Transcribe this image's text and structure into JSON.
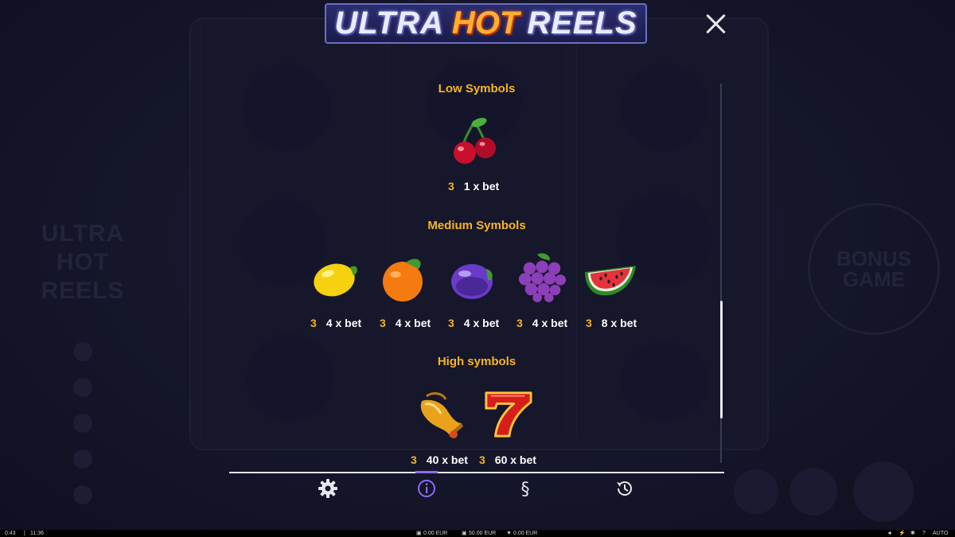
{
  "logo": {
    "word1": "ULTRA",
    "word2": "HOT",
    "word3": "REELS"
  },
  "background": {
    "left_logo": [
      "ULTRA",
      "HOT",
      "REELS"
    ],
    "bonus_badge": [
      "BONUS",
      "GAME"
    ]
  },
  "sections": {
    "low": {
      "title": "Low Symbols",
      "symbols": [
        {
          "icon": "cherry-icon",
          "count": "3",
          "payout": "1 x bet"
        }
      ]
    },
    "medium": {
      "title": "Medium Symbols",
      "symbols": [
        {
          "icon": "lemon-icon",
          "count": "3",
          "payout": "4 x bet"
        },
        {
          "icon": "orange-icon",
          "count": "3",
          "payout": "4 x bet"
        },
        {
          "icon": "plum-icon",
          "count": "3",
          "payout": "4 x bet"
        },
        {
          "icon": "grapes-icon",
          "count": "3",
          "payout": "4 x bet"
        },
        {
          "icon": "watermelon-icon",
          "count": "3",
          "payout": "8 x bet"
        }
      ]
    },
    "high": {
      "title": "High symbols",
      "symbols": [
        {
          "icon": "bell-icon",
          "count": "3",
          "payout": "40 x bet"
        },
        {
          "icon": "seven-icon",
          "count": "3",
          "payout": "60 x bet"
        }
      ]
    }
  },
  "nav": {
    "items": [
      "settings-icon",
      "info-icon",
      "rules-icon",
      "history-icon"
    ],
    "active": "info-icon"
  },
  "status": {
    "session_time": "0:43",
    "clock": "11:36",
    "balance": "0.00 EUR",
    "bet": "50.00 EUR",
    "win": "0.00 EUR",
    "auto": "AUTO"
  },
  "colors": {
    "accent": "#f7b521",
    "active": "#8a6cff",
    "background": "#15162a"
  }
}
